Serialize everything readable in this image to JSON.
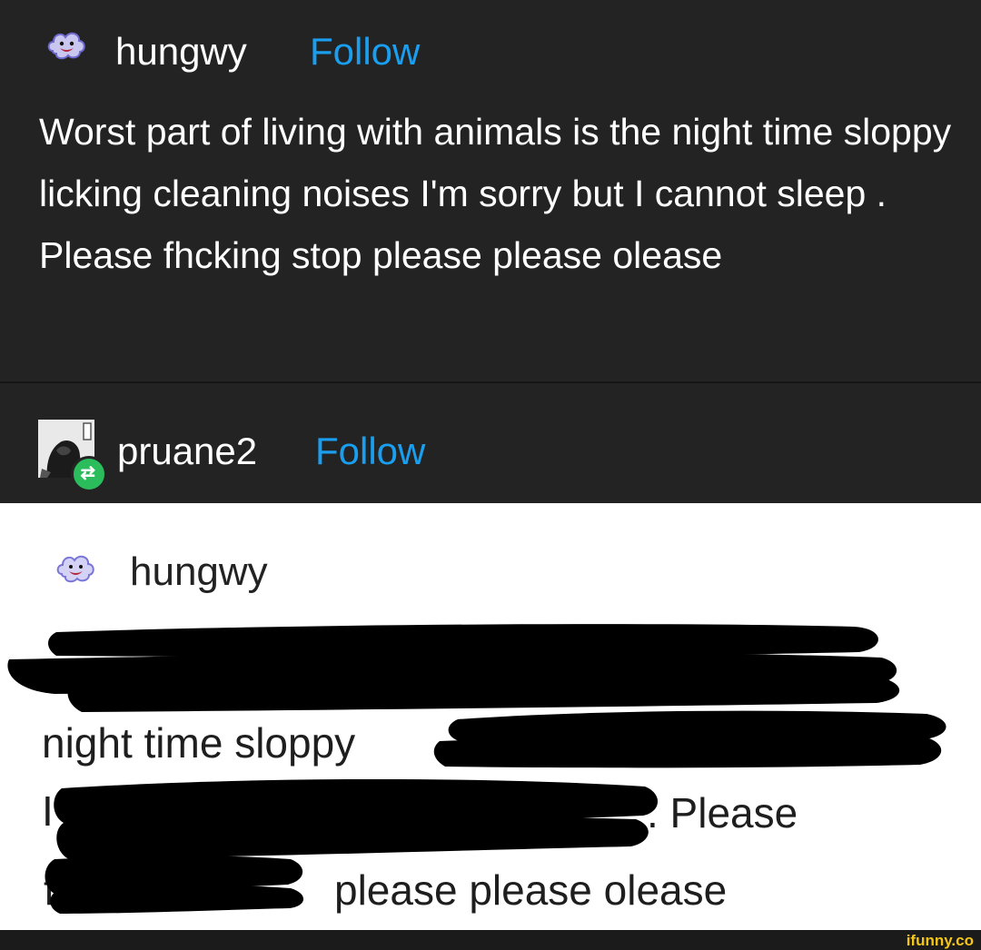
{
  "post": {
    "username": "hungwy",
    "follow_label": "Follow",
    "text": "Worst part of living with animals is the night time sloppy licking cleaning noises I'm sorry but I cannot sleep . Please fhcking stop please please olease"
  },
  "reblog": {
    "username": "pruane2",
    "follow_label": "Follow"
  },
  "screenshot": {
    "username": "hungwy",
    "line2": "night time sloppy",
    "line3_fragment": "I'",
    "line3_end": ". Please",
    "line4_fragment": "f",
    "line4_end": "please please olease"
  },
  "watermark": "ifunny.co",
  "colors": {
    "background": "#232323",
    "text": "#ffffff",
    "follow": "#1a9ff0",
    "reblog_badge": "#2bbd5b",
    "redaction": "#000000",
    "watermark": "#f5c518"
  },
  "icons": {
    "post_avatar": "smiling-cloud-icon",
    "reblog_avatar": "user-avatar-icon",
    "reblog_badge": "reblog-icon"
  }
}
